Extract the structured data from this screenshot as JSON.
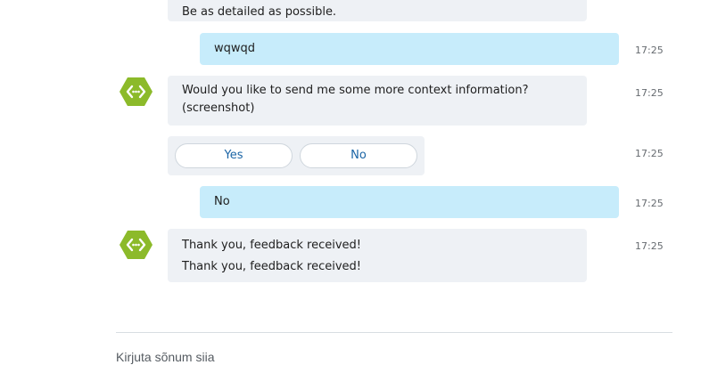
{
  "messages": {
    "intro_tail": "Be as detailed as possible.",
    "user_1": {
      "text": "wqwqd",
      "time": "17:25"
    },
    "bot_question": {
      "line1": "Would you like to send me some more context information?",
      "line2": "(screenshot)",
      "time": "17:25"
    },
    "choices": {
      "yes": "Yes",
      "no": "No",
      "time": "17:25"
    },
    "user_2": {
      "text": "No",
      "time": "17:25"
    },
    "bot_thanks": {
      "line1": "Thank you, feedback received!",
      "line2": "Thank you, feedback received!",
      "time": "17:25"
    }
  },
  "composer": {
    "placeholder": "Kirjuta sõnum siia"
  },
  "icons": {
    "bot_avatar": "bot-hexagon-code-icon"
  },
  "colors": {
    "avatar": "#8cba2a",
    "user_bubble": "#c7ecfb",
    "bot_bubble": "#eef1f5",
    "choice_text": "#1a64a5"
  }
}
